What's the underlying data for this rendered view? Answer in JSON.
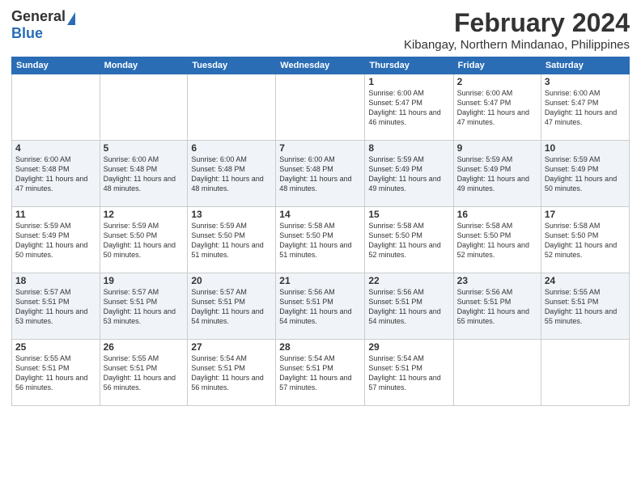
{
  "logo": {
    "general": "General",
    "blue": "Blue"
  },
  "title": "February 2024",
  "location": "Kibangay, Northern Mindanao, Philippines",
  "headers": [
    "Sunday",
    "Monday",
    "Tuesday",
    "Wednesday",
    "Thursday",
    "Friday",
    "Saturday"
  ],
  "weeks": [
    [
      {
        "day": "",
        "sunrise": "",
        "sunset": "",
        "daylight": ""
      },
      {
        "day": "",
        "sunrise": "",
        "sunset": "",
        "daylight": ""
      },
      {
        "day": "",
        "sunrise": "",
        "sunset": "",
        "daylight": ""
      },
      {
        "day": "",
        "sunrise": "",
        "sunset": "",
        "daylight": ""
      },
      {
        "day": "1",
        "sunrise": "Sunrise: 6:00 AM",
        "sunset": "Sunset: 5:47 PM",
        "daylight": "Daylight: 11 hours and 46 minutes."
      },
      {
        "day": "2",
        "sunrise": "Sunrise: 6:00 AM",
        "sunset": "Sunset: 5:47 PM",
        "daylight": "Daylight: 11 hours and 47 minutes."
      },
      {
        "day": "3",
        "sunrise": "Sunrise: 6:00 AM",
        "sunset": "Sunset: 5:47 PM",
        "daylight": "Daylight: 11 hours and 47 minutes."
      }
    ],
    [
      {
        "day": "4",
        "sunrise": "Sunrise: 6:00 AM",
        "sunset": "Sunset: 5:48 PM",
        "daylight": "Daylight: 11 hours and 47 minutes."
      },
      {
        "day": "5",
        "sunrise": "Sunrise: 6:00 AM",
        "sunset": "Sunset: 5:48 PM",
        "daylight": "Daylight: 11 hours and 48 minutes."
      },
      {
        "day": "6",
        "sunrise": "Sunrise: 6:00 AM",
        "sunset": "Sunset: 5:48 PM",
        "daylight": "Daylight: 11 hours and 48 minutes."
      },
      {
        "day": "7",
        "sunrise": "Sunrise: 6:00 AM",
        "sunset": "Sunset: 5:48 PM",
        "daylight": "Daylight: 11 hours and 48 minutes."
      },
      {
        "day": "8",
        "sunrise": "Sunrise: 5:59 AM",
        "sunset": "Sunset: 5:49 PM",
        "daylight": "Daylight: 11 hours and 49 minutes."
      },
      {
        "day": "9",
        "sunrise": "Sunrise: 5:59 AM",
        "sunset": "Sunset: 5:49 PM",
        "daylight": "Daylight: 11 hours and 49 minutes."
      },
      {
        "day": "10",
        "sunrise": "Sunrise: 5:59 AM",
        "sunset": "Sunset: 5:49 PM",
        "daylight": "Daylight: 11 hours and 50 minutes."
      }
    ],
    [
      {
        "day": "11",
        "sunrise": "Sunrise: 5:59 AM",
        "sunset": "Sunset: 5:49 PM",
        "daylight": "Daylight: 11 hours and 50 minutes."
      },
      {
        "day": "12",
        "sunrise": "Sunrise: 5:59 AM",
        "sunset": "Sunset: 5:50 PM",
        "daylight": "Daylight: 11 hours and 50 minutes."
      },
      {
        "day": "13",
        "sunrise": "Sunrise: 5:59 AM",
        "sunset": "Sunset: 5:50 PM",
        "daylight": "Daylight: 11 hours and 51 minutes."
      },
      {
        "day": "14",
        "sunrise": "Sunrise: 5:58 AM",
        "sunset": "Sunset: 5:50 PM",
        "daylight": "Daylight: 11 hours and 51 minutes."
      },
      {
        "day": "15",
        "sunrise": "Sunrise: 5:58 AM",
        "sunset": "Sunset: 5:50 PM",
        "daylight": "Daylight: 11 hours and 52 minutes."
      },
      {
        "day": "16",
        "sunrise": "Sunrise: 5:58 AM",
        "sunset": "Sunset: 5:50 PM",
        "daylight": "Daylight: 11 hours and 52 minutes."
      },
      {
        "day": "17",
        "sunrise": "Sunrise: 5:58 AM",
        "sunset": "Sunset: 5:50 PM",
        "daylight": "Daylight: 11 hours and 52 minutes."
      }
    ],
    [
      {
        "day": "18",
        "sunrise": "Sunrise: 5:57 AM",
        "sunset": "Sunset: 5:51 PM",
        "daylight": "Daylight: 11 hours and 53 minutes."
      },
      {
        "day": "19",
        "sunrise": "Sunrise: 5:57 AM",
        "sunset": "Sunset: 5:51 PM",
        "daylight": "Daylight: 11 hours and 53 minutes."
      },
      {
        "day": "20",
        "sunrise": "Sunrise: 5:57 AM",
        "sunset": "Sunset: 5:51 PM",
        "daylight": "Daylight: 11 hours and 54 minutes."
      },
      {
        "day": "21",
        "sunrise": "Sunrise: 5:56 AM",
        "sunset": "Sunset: 5:51 PM",
        "daylight": "Daylight: 11 hours and 54 minutes."
      },
      {
        "day": "22",
        "sunrise": "Sunrise: 5:56 AM",
        "sunset": "Sunset: 5:51 PM",
        "daylight": "Daylight: 11 hours and 54 minutes."
      },
      {
        "day": "23",
        "sunrise": "Sunrise: 5:56 AM",
        "sunset": "Sunset: 5:51 PM",
        "daylight": "Daylight: 11 hours and 55 minutes."
      },
      {
        "day": "24",
        "sunrise": "Sunrise: 5:55 AM",
        "sunset": "Sunset: 5:51 PM",
        "daylight": "Daylight: 11 hours and 55 minutes."
      }
    ],
    [
      {
        "day": "25",
        "sunrise": "Sunrise: 5:55 AM",
        "sunset": "Sunset: 5:51 PM",
        "daylight": "Daylight: 11 hours and 56 minutes."
      },
      {
        "day": "26",
        "sunrise": "Sunrise: 5:55 AM",
        "sunset": "Sunset: 5:51 PM",
        "daylight": "Daylight: 11 hours and 56 minutes."
      },
      {
        "day": "27",
        "sunrise": "Sunrise: 5:54 AM",
        "sunset": "Sunset: 5:51 PM",
        "daylight": "Daylight: 11 hours and 56 minutes."
      },
      {
        "day": "28",
        "sunrise": "Sunrise: 5:54 AM",
        "sunset": "Sunset: 5:51 PM",
        "daylight": "Daylight: 11 hours and 57 minutes."
      },
      {
        "day": "29",
        "sunrise": "Sunrise: 5:54 AM",
        "sunset": "Sunset: 5:51 PM",
        "daylight": "Daylight: 11 hours and 57 minutes."
      },
      {
        "day": "",
        "sunrise": "",
        "sunset": "",
        "daylight": ""
      },
      {
        "day": "",
        "sunrise": "",
        "sunset": "",
        "daylight": ""
      }
    ]
  ]
}
